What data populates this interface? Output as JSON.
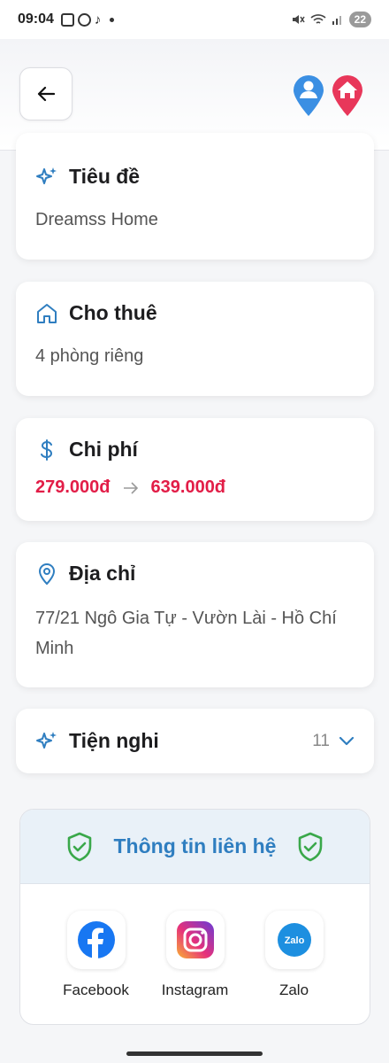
{
  "status_bar": {
    "time": "09:04",
    "battery": "22",
    "icons": [
      "screenshot-icon",
      "instagram-icon",
      "tiktok-icon",
      "mute-icon",
      "wifi-icon",
      "signal-icon"
    ]
  },
  "header": {
    "back_icon": "arrow-left-icon",
    "pins": [
      "user-pin-icon",
      "home-pin-icon"
    ],
    "colors": {
      "user_pin": "#3b8fe3",
      "home_pin": "#e8375a"
    }
  },
  "title_card": {
    "label": "Tiêu đề",
    "value": "Dreamss Home",
    "icon": "sparkle-icon"
  },
  "rent_card": {
    "label": "Cho thuê",
    "value": "4 phòng riêng",
    "icon": "house-icon"
  },
  "cost_card": {
    "label": "Chi phí",
    "min": "279.000đ",
    "max": "639.000đ",
    "icon": "dollar-icon",
    "price_color": "#e21d47"
  },
  "address_card": {
    "label": "Địa chỉ",
    "value": "77/21 Ngô Gia Tự - Vườn Lài - Hồ Chí Minh",
    "icon": "location-pin-icon"
  },
  "amenities_card": {
    "label": "Tiện nghi",
    "count": "11",
    "icon": "sparkle-icon"
  },
  "contact": {
    "title": "Thông tin liên hệ",
    "accent": "#2f7ec0",
    "socials": [
      {
        "label": "Facebook",
        "icon": "facebook-icon"
      },
      {
        "label": "Instagram",
        "icon": "instagram-icon"
      },
      {
        "label": "Zalo",
        "icon": "zalo-icon"
      }
    ]
  }
}
